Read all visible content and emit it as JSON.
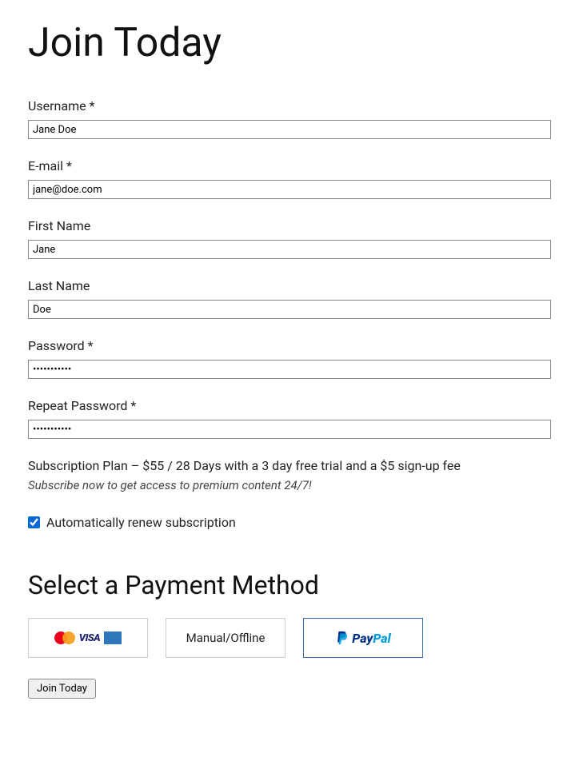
{
  "title": "Join Today",
  "fields": {
    "username": {
      "label": "Username *",
      "value": "Jane Doe"
    },
    "email": {
      "label": "E-mail *",
      "value": "jane@doe.com"
    },
    "firstname": {
      "label": "First Name",
      "value": "Jane"
    },
    "lastname": {
      "label": "Last Name",
      "value": "Doe"
    },
    "password": {
      "label": "Password *",
      "value": "•••••••••••"
    },
    "repeat_password": {
      "label": "Repeat Password *",
      "value": "•••••••••••"
    }
  },
  "plan": {
    "text": "Subscription Plan – $55 / 28 Days with a 3 day free trial and a $5 sign-up fee",
    "description": "Subscribe now to get access to premium content 24/7!"
  },
  "auto_renew": {
    "label": "Automatically renew subscription",
    "checked": true
  },
  "payment": {
    "title": "Select a Payment Method",
    "methods": {
      "manual": "Manual/Offline",
      "paypal_pay": "Pay",
      "paypal_pal": "Pal"
    }
  },
  "submit": "Join Today"
}
